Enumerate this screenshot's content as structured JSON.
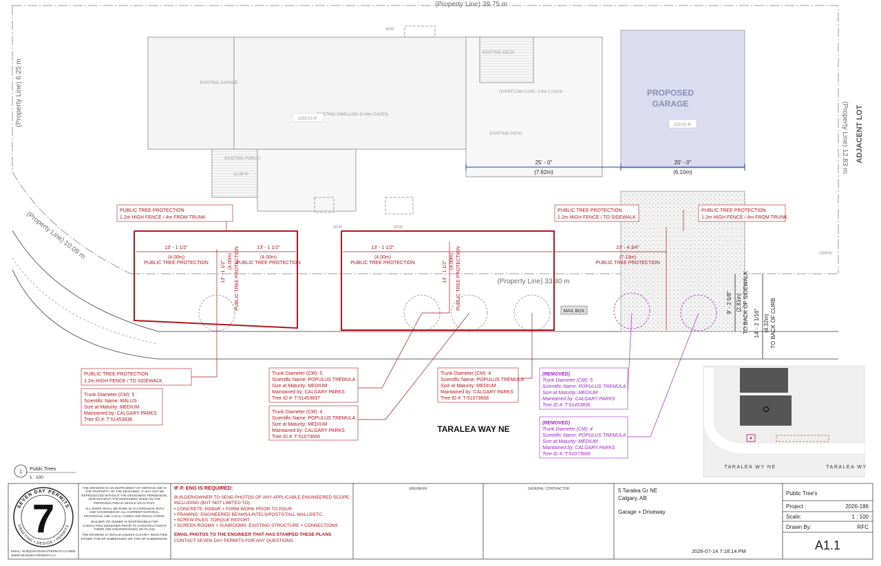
{
  "property_lines": {
    "top": "(Property Line)  39.75 m",
    "left": "(Property Line)  6.25 m",
    "right": "(Property Line)  12.83 m",
    "diagonal": "(Property Line)  10.09 m",
    "front": "(Property Line)  33.40 m"
  },
  "adjacent_lot": "ADJACENT LOT",
  "odrw": "ODRW",
  "street_name": "TARALEA WAY NE",
  "structures": {
    "existing_garage": "EXISTING GARAGE",
    "existing_dwelling": "EXISTING DWELLING (0.46m EAVES)",
    "dwelling_area": "1189.63 ft²",
    "existing_deck": "EXISTING DECK",
    "existing_patio": "EXISTING PATIO",
    "existing_porch": "EXISTING PORCH",
    "porch_area": "21.69 ft²",
    "proposed_garage_line1": "PROPOSED",
    "proposed_garage_line2": "GARAGE",
    "proposed_area": "520.00 ft²",
    "mail_box": "MAIL BOX",
    "ww": "W/W",
    "overhead_note": "OVERFLOW CANE, 3.6m x 0.61m"
  },
  "dimensions": {
    "d1": "25' - 0\"",
    "d1m": "(7.62m)",
    "d2": "20' - 0\"",
    "d2m": "(6.10m)",
    "p1": "13' - 1 1/2\"",
    "p1m": "(4.00m)",
    "ptp": "PUBLIC TREE PROTECTION",
    "p2": "23' - 4 3/4\"",
    "p2m": "(7.13m)",
    "v1": "13' - 1 1/2\"",
    "v1m": "(4.00m)",
    "s1": "9' - 2 5/8\"",
    "s1m": "(2.81m)",
    "s1t": "TO BACK OF SIDEWALK",
    "s2": "14' - 2 1/16\"",
    "s2m": "(4.32m)",
    "s2t": "TO BACK OF CURB"
  },
  "callouts": {
    "a1": "PUBLIC TREE PROTECTION",
    "a2": "1.2m HIGH FENCE / 4m FROM TRUNK",
    "b1": "PUBLIC TREE PROTECTION",
    "b2": "1.2m HIGH FENCE / TO SIDEWALK",
    "c1": "PUBLIC TREE PROTECTION",
    "c2": "1.2m HIGH FENCE / 4m FROM TRUNK",
    "d1": "PUBLIC TREE PROTECTION",
    "d2": "1.2m HIGH FENCE / TO SIDEWALK"
  },
  "trees": [
    {
      "l1": "Trunk Diameter (CM): 5",
      "l2": "Scientific Name: MALUS",
      "l3": "Size at Maturity: MEDIUM",
      "l4": "Maintained by: CALGARY PARKS",
      "l5": "Tree ID #: T-51453838"
    },
    {
      "l1": "Trunk Diameter (CM): 5",
      "l2": "Scientific Name: POPULUS TREMULA",
      "l3": "Size at Maturity: MEDIUM",
      "l4": "Maintained by: CALGARY PARKS",
      "l5": "Tree ID #: T-51453837"
    },
    {
      "l1": "Trunk Diameter (CM): 4",
      "l2": "Scientific Name: POPULUS TREMULA",
      "l3": "Size at Maturity: MEDIUM",
      "l4": "Maintained by: CALGARY PARKS",
      "l5": "Tree ID #: T-51073666"
    },
    {
      "l1": "Trunk Diameter (CM): 4",
      "l2": "Scientific Name: POPULUS TREMULA",
      "l3": "Size at Maturity: MEDIUM",
      "l4": "Maintained by: CALGARY PARKS",
      "l5": "Tree ID #: T-51073668"
    }
  ],
  "removed_trees": [
    {
      "tag": "(REMOVED)",
      "l1": "Trunk Diameter (CM): 5",
      "l2": "Scientific Name: POPULUS TREMULA",
      "l3": "Size at Maturity: MEDIUM",
      "l4": "Maintained by: CALGARY PARKS",
      "l5": "Tree ID #: T-51453836"
    },
    {
      "tag": "(REMOVED)",
      "l1": "Trunk Diameter (CM): 4",
      "l2": "Scientific Name: POPULUS TREMULA",
      "l3": "Size at Maturity: MEDIUM",
      "l4": "Maintained by: CALGARY PARKS",
      "l5": "Tree ID #: T-51073669"
    }
  ],
  "key_plan": {
    "street1": "TARALEA WY NE",
    "street2": "TARALEA WY"
  },
  "view": {
    "number": "1",
    "title": "Public Trees",
    "scale": "1 : 100"
  },
  "title_block": {
    "disclaimer": [
      "THE DRAWING IS AN INSTRUMENT OF SERVICE AND IS",
      "THE PROPERTY OF THE DESIGNER. IT MAY NOT BE",
      "REPRODUCED WITHOUT THE DESIGNERS PERMISSION,",
      "NOR WITHOUT THE DESIGNERS NAME ON THE",
      "REPRODUCTION IN WHOLE OR IN PART.",
      "",
      "ALL WORK SHALL BE DONE IN ACCORDANCE WITH",
      "AND GOVERNED BY ALL CURRENT NATIONAL,",
      "PROVINCIAL AND LOCAL CODES AND REGULATIONS.",
      "",
      "BUILDER OR OWNER IS RESPONSIBLE FOR",
      "CONTACTING DESIGNER PRIOR TO CONSTRUCTION IF",
      "THERE ARE DISCREPANCIES ON PLANS.",
      "",
      "THE DRAWING IS INVALID UNLESS CLEARLY INDICATED",
      "EITHER 'FOR BP SUBMISSION' OR 'FOR DP SUBMISSION'."
    ],
    "email_web": "EMAIL: ROB@SEVENDAYPERMITS.CA   WEB: WWW.SEVENDAYPERMITS.CA",
    "logo_top": "SEVEN DAY PERMITS",
    "logo_bottom": "DRAFTING • DESIGN • PERMITS",
    "logo_number": "7",
    "peng_title": "IF P. ENG IS REQUIRED:",
    "peng_lines": [
      "BUILDER/OWNER TO SEND PHOTOS OF ANY APPLICABLE ENGINEERED SCOPE;",
      "INCLUDING (BUT NOT LIMITED TO):",
      "• CONCRETE: REBAR + FORM WORK PRIOR TO POUR",
      "• FRAMING: ENGINEERED BEAMS/LINTELS/POSTS/TALL WALLS/ETC.",
      "• SCREW PILES: TORQUE REPORT",
      "• SCREEN ROOMS + SUNROOMS: EXISTING STRUCTURE + CONNECTIONS"
    ],
    "peng_email1": "EMAIL PHOTOS TO THE ENGINEER THAT HAS STAMPED THESE PLANS",
    "peng_email2": "CONTACT SEVEN DAY PERMITS FOR ANY QUESTIONS.",
    "engineer_label": "ENGINEER",
    "contractor_label": "GENERAL CONTRACTOR",
    "address1": "5 Taralea Gr NE",
    "address2": "Calgary, AB",
    "scope": "Garage + Driveway",
    "timestamp": "2026-07-14 7:18:14 PM",
    "sheet_title": "Public Tree's",
    "project_label": "Project :",
    "project_value": "2026-186",
    "scale_label": "Scale:",
    "scale_value": "1 : 100",
    "drawn_label": "Drawn By:",
    "drawn_value": "RFC",
    "sheet_number": "A1.1"
  },
  "colors": {
    "tree_protection": "#b3141b",
    "removed": "#a020c8",
    "dimension": "#1a3fa0",
    "proposed": "#dcdcf0"
  }
}
